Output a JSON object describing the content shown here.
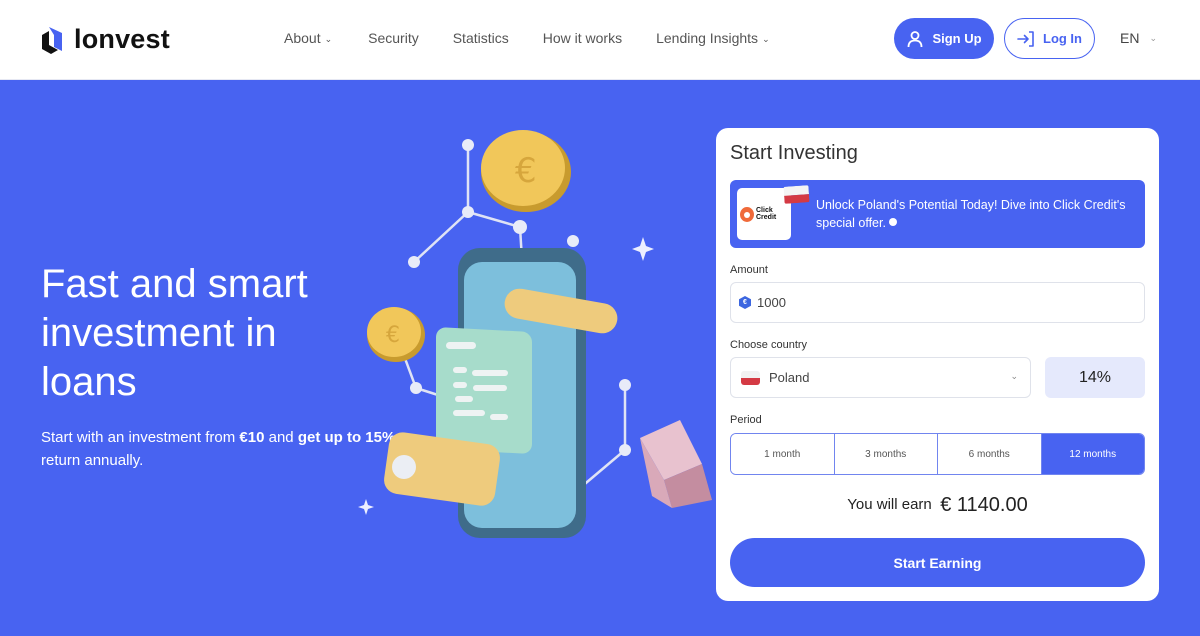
{
  "brand": {
    "name": "lonvest",
    "accent": "#4863F1"
  },
  "nav": {
    "items": [
      {
        "label": "About",
        "has_dropdown": true
      },
      {
        "label": "Security",
        "has_dropdown": false
      },
      {
        "label": "Statistics",
        "has_dropdown": false
      },
      {
        "label": "How it works",
        "has_dropdown": false
      },
      {
        "label": "Lending Insights",
        "has_dropdown": true
      }
    ],
    "signup_label": "Sign Up",
    "login_label": "Log In",
    "language": "EN"
  },
  "hero": {
    "title": "Fast and smart investment in loans",
    "sub_prefix": "Start with an investment from ",
    "sub_min": "€10",
    "sub_mid": " and ",
    "sub_upto": "get up to 15%",
    "sub_suffix": " return annually."
  },
  "calculator": {
    "title": "Start Investing",
    "promo": {
      "partner": "Click Credit",
      "partner_line1": "Click",
      "partner_line2": "Credit",
      "text": "Unlock Poland's Potential Today! Dive into Click Credit's special offer."
    },
    "amount_label": "Amount",
    "amount_value": "1000",
    "currency_symbol": "€",
    "country_label": "Choose country",
    "country_value": "Poland",
    "rate": "14%",
    "period_label": "Period",
    "periods": [
      {
        "label": "1 month",
        "active": false
      },
      {
        "label": "3 months",
        "active": false
      },
      {
        "label": "6 months",
        "active": false
      },
      {
        "label": "12 months",
        "active": true
      }
    ],
    "earn_label": "You will earn",
    "earn_amount": "€ 1140.00",
    "cta_label": "Start Earning"
  }
}
